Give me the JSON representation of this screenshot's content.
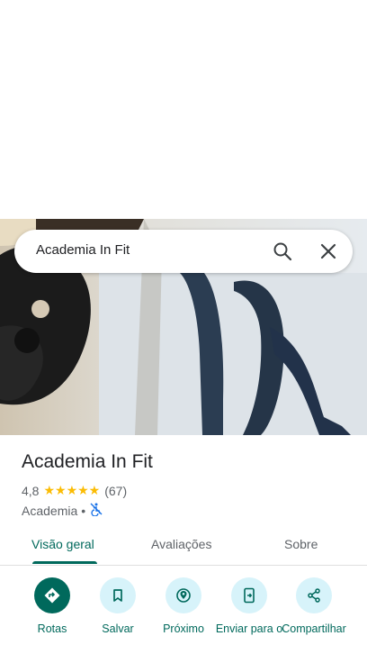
{
  "search": {
    "query": "Academia In Fit"
  },
  "place": {
    "name": "Academia In Fit",
    "rating": "4,8",
    "stars": "★★★★★",
    "review_count": "(67)",
    "category": "Academia",
    "separator": "•"
  },
  "tabs": [
    {
      "label": "Visão geral",
      "active": true
    },
    {
      "label": "Avaliações",
      "active": false
    },
    {
      "label": "Sobre",
      "active": false
    }
  ],
  "actions": [
    {
      "label": "Rotas",
      "icon": "directions-icon"
    },
    {
      "label": "Salvar",
      "icon": "bookmark-icon"
    },
    {
      "label": "Próximo",
      "icon": "nearby-icon"
    },
    {
      "label": "Enviar para o",
      "icon": "send-to-phone-icon"
    },
    {
      "label": "Compartilhar",
      "icon": "share-icon"
    }
  ],
  "colors": {
    "accent": "#00695c",
    "star": "#fbbc04",
    "chip_bg": "#d7f3fa"
  }
}
